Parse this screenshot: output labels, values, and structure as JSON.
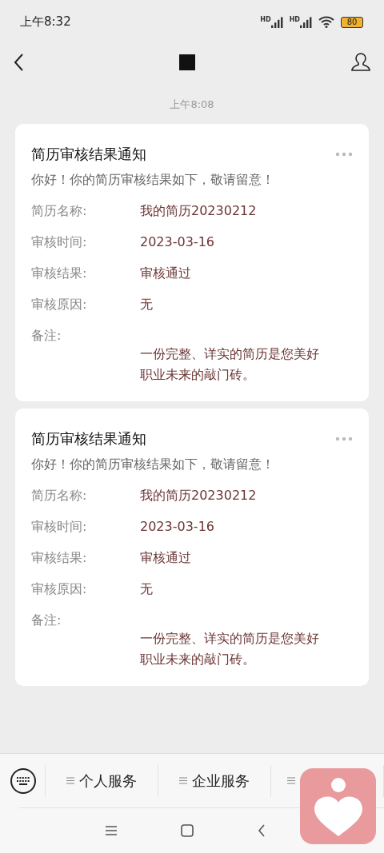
{
  "status_bar": {
    "time": "上午8:32",
    "signals": [
      {
        "label": "HD"
      },
      {
        "label": "HD"
      }
    ],
    "battery": "80"
  },
  "header": {
    "title_redacted": true
  },
  "timestamp": "上午8:08",
  "messages": [
    {
      "title": "简历审核结果通知",
      "greeting": "你好！你的简历审核结果如下，敬请留意！",
      "fields": [
        {
          "label": "简历名称:",
          "value": "我的简历20230212"
        },
        {
          "label": "审核时间:",
          "value": "2023-03-16"
        },
        {
          "label": "审核结果:",
          "value": "审核通过"
        },
        {
          "label": "审核原因:",
          "value": "无"
        }
      ],
      "note": {
        "label": "备注:",
        "value": "一份完整、详实的简历是您美好职业未来的敲门砖。"
      }
    },
    {
      "title": "简历审核结果通知",
      "greeting": "你好！你的简历审核结果如下，敬请留意！",
      "fields": [
        {
          "label": "简历名称:",
          "value": "我的简历20230212"
        },
        {
          "label": "审核时间:",
          "value": "2023-03-16"
        },
        {
          "label": "审核结果:",
          "value": "审核通过"
        },
        {
          "label": "审核原因:",
          "value": "无"
        }
      ],
      "note": {
        "label": "备注:",
        "value": "一份完整、详实的简历是您美好职业未来的敲门砖。"
      }
    }
  ],
  "menu": [
    {
      "label": "个人服务"
    },
    {
      "label": "企业服务"
    }
  ]
}
